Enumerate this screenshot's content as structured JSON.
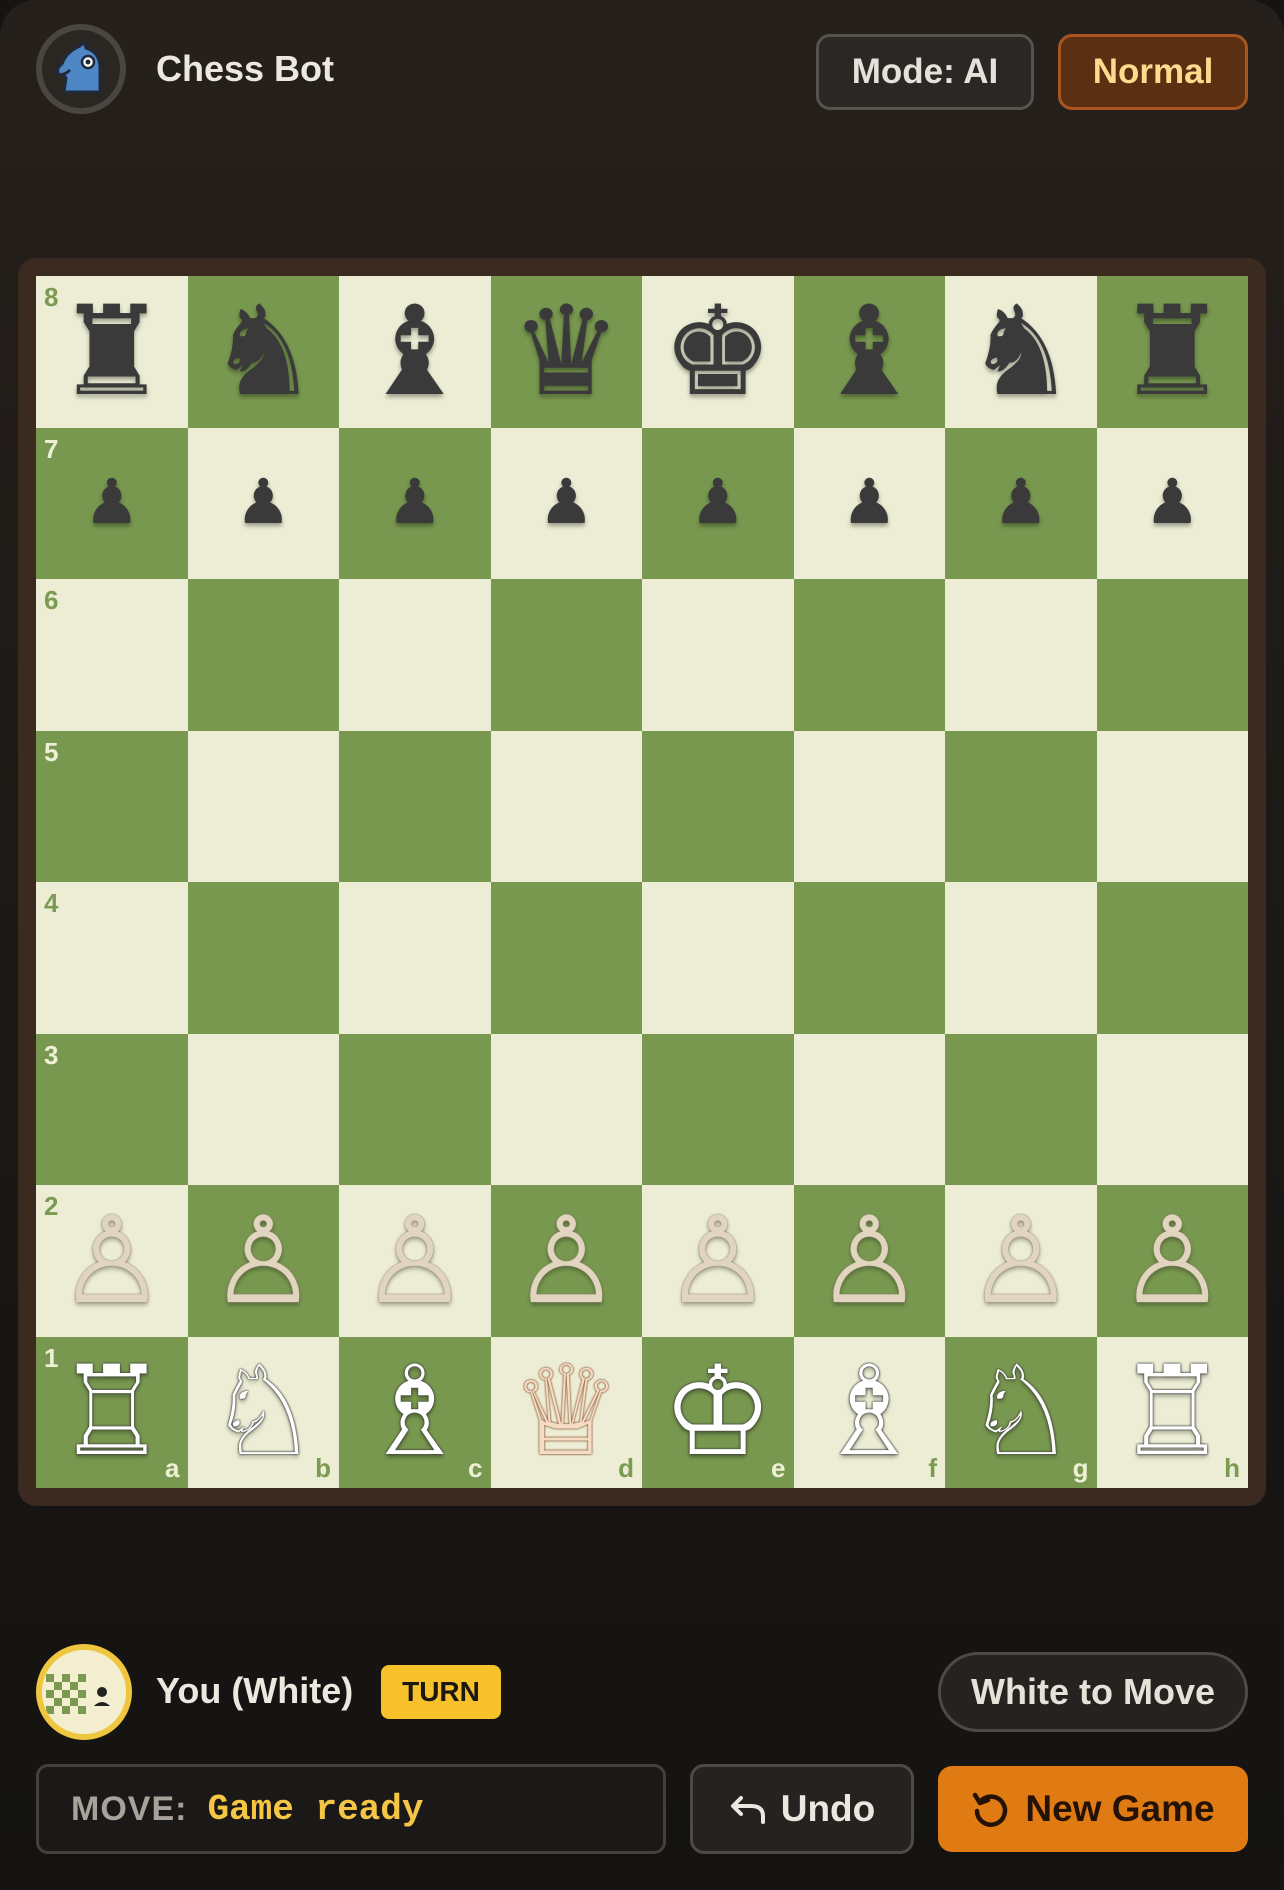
{
  "header": {
    "bot_name": "Chess Bot",
    "mode_label": "Mode: AI",
    "level_label": "Normal"
  },
  "board": {
    "ranks": [
      "8",
      "7",
      "6",
      "5",
      "4",
      "3",
      "2",
      "1"
    ],
    "files": [
      "a",
      "b",
      "c",
      "d",
      "e",
      "f",
      "g",
      "h"
    ],
    "position": [
      [
        "♜",
        "♞",
        "♝",
        "♛",
        "♚",
        "♝",
        "♞",
        "♜"
      ],
      [
        "♟",
        "♟",
        "♟",
        "♟",
        "♟",
        "♟",
        "♟",
        "♟"
      ],
      [
        "",
        "",
        "",
        "",
        "",
        "",
        "",
        ""
      ],
      [
        "",
        "",
        "",
        "",
        "",
        "",
        "",
        ""
      ],
      [
        "",
        "",
        "",
        "",
        "",
        "",
        "",
        ""
      ],
      [
        "",
        "",
        "",
        "",
        "",
        "",
        "",
        ""
      ],
      [
        "♙",
        "♙",
        "♙",
        "♙",
        "♙",
        "♙",
        "♙",
        "♙"
      ],
      [
        "♖",
        "♘",
        "♗",
        "♕",
        "♔",
        "♗",
        "♘",
        "♖"
      ]
    ],
    "light_color": "#ecedd4",
    "dark_color": "#78984f"
  },
  "player": {
    "name": "You (White)",
    "turn_badge": "TURN",
    "status": "White to Move"
  },
  "controls": {
    "move_label": "MOVE:",
    "move_value": "Game ready",
    "undo_label": "Undo",
    "new_game_label": "New Game"
  },
  "colors": {
    "accent_orange": "#e07a12",
    "turn_yellow": "#f6c12a",
    "move_text": "#f4c644"
  }
}
